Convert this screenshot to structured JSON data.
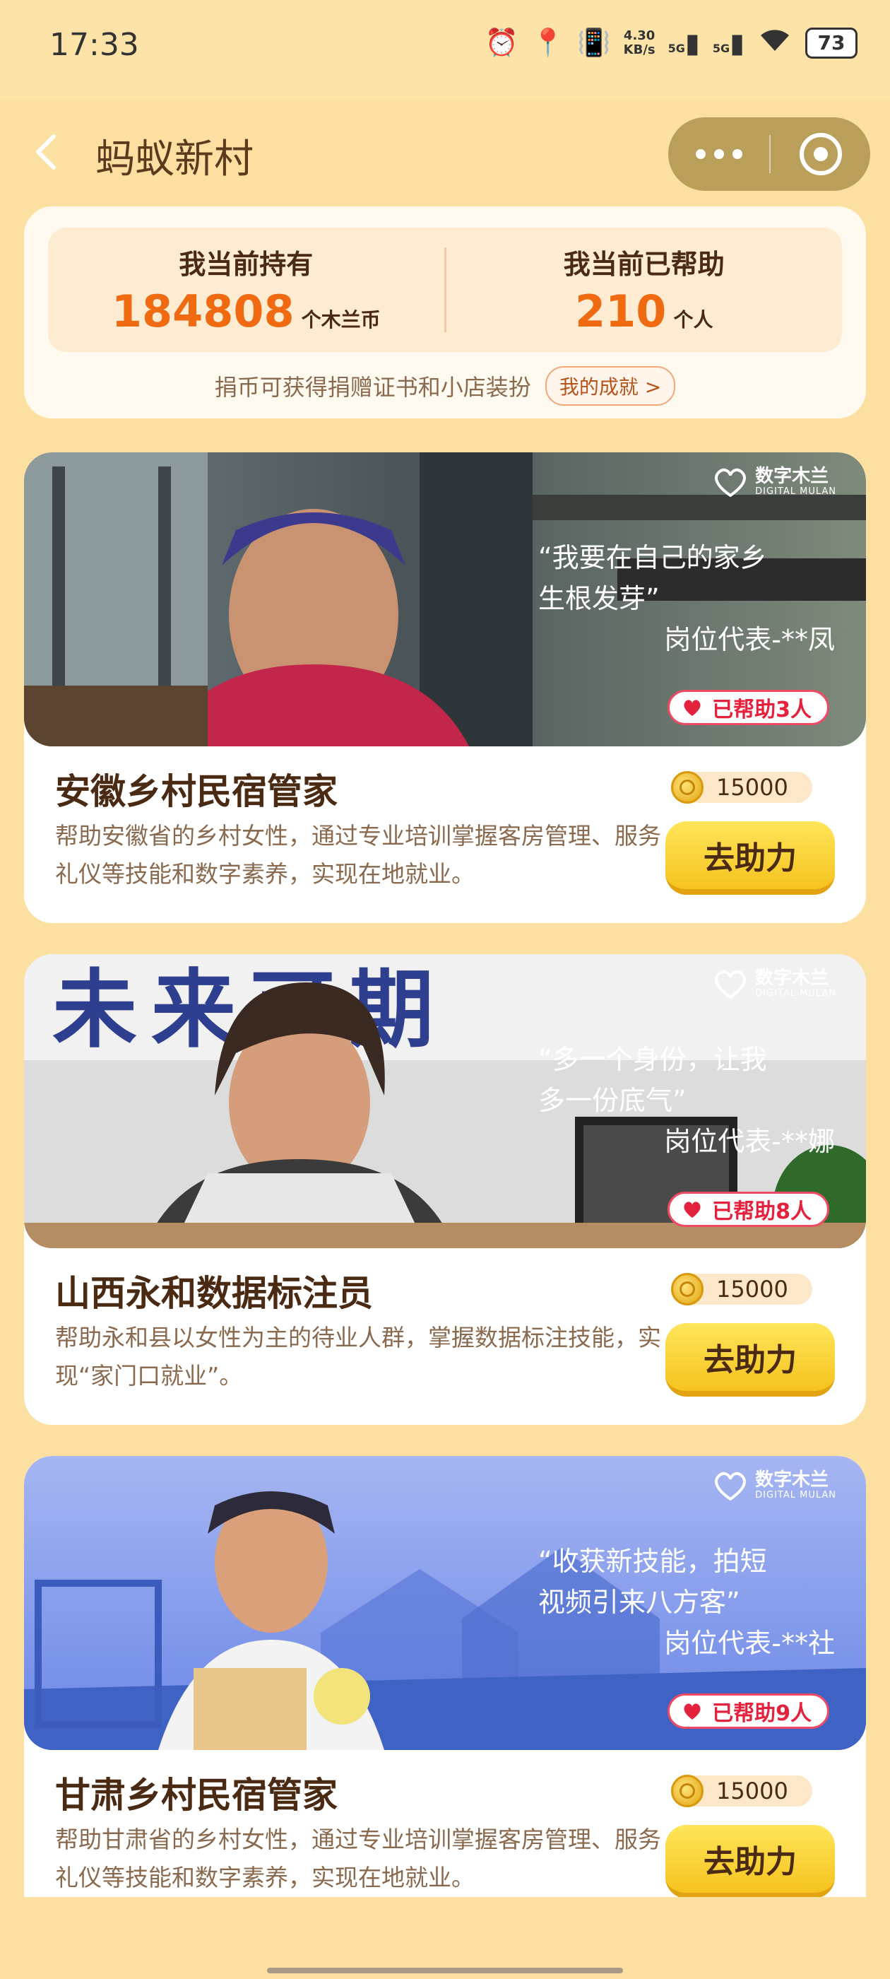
{
  "status": {
    "time": "17:33",
    "net_speed_value": "4.30",
    "net_speed_unit": "KB/s",
    "sim1": "5G",
    "sim2": "5G",
    "battery": "73"
  },
  "nav": {
    "title": "蚂蚁新村"
  },
  "summary": {
    "holding_label": "我当前持有",
    "holding_value": "184808",
    "holding_unit": "个木兰币",
    "helped_label": "我当前已帮助",
    "helped_value": "210",
    "helped_unit": "个人",
    "hint": "捐币可获得捐赠证书和小店装扮",
    "achievement_link": "我的成就 >"
  },
  "brand": {
    "name": "数字木兰",
    "sub": "DIGITAL MULAN"
  },
  "jobs": [
    {
      "quote_line1": "“我要在自己的家乡",
      "quote_line2": "生根发芽”",
      "rep": "岗位代表-**凤",
      "helped": "已帮助3人",
      "title": "安徽乡村民宿管家",
      "desc": "帮助安徽省的乡村女性，通过专业培训掌握客房管理、服务礼仪等技能和数字素养，实现在地就业。",
      "coins": "15000",
      "button": "去助力"
    },
    {
      "quote_line1": "“多一个身份，让我",
      "quote_line2": "多一份底气”",
      "rep": "岗位代表-**娜",
      "helped": "已帮助8人",
      "title": "山西永和数据标注员",
      "desc": "帮助永和县以女性为主的待业人群，掌握数据标注技能，实现“家门口就业”。",
      "coins": "15000",
      "button": "去助力",
      "sign": "未来可期"
    },
    {
      "quote_line1": "“收获新技能，拍短",
      "quote_line2": "视频引来八方客”",
      "rep": "岗位代表-**社",
      "helped": "已帮助9人",
      "title": "甘肃乡村民宿管家",
      "desc": "帮助甘肃省的乡村女性，通过专业培训掌握客房管理、服务礼仪等技能和数字素养，实现在地就业。",
      "coins": "15000",
      "button": "去助力"
    }
  ]
}
